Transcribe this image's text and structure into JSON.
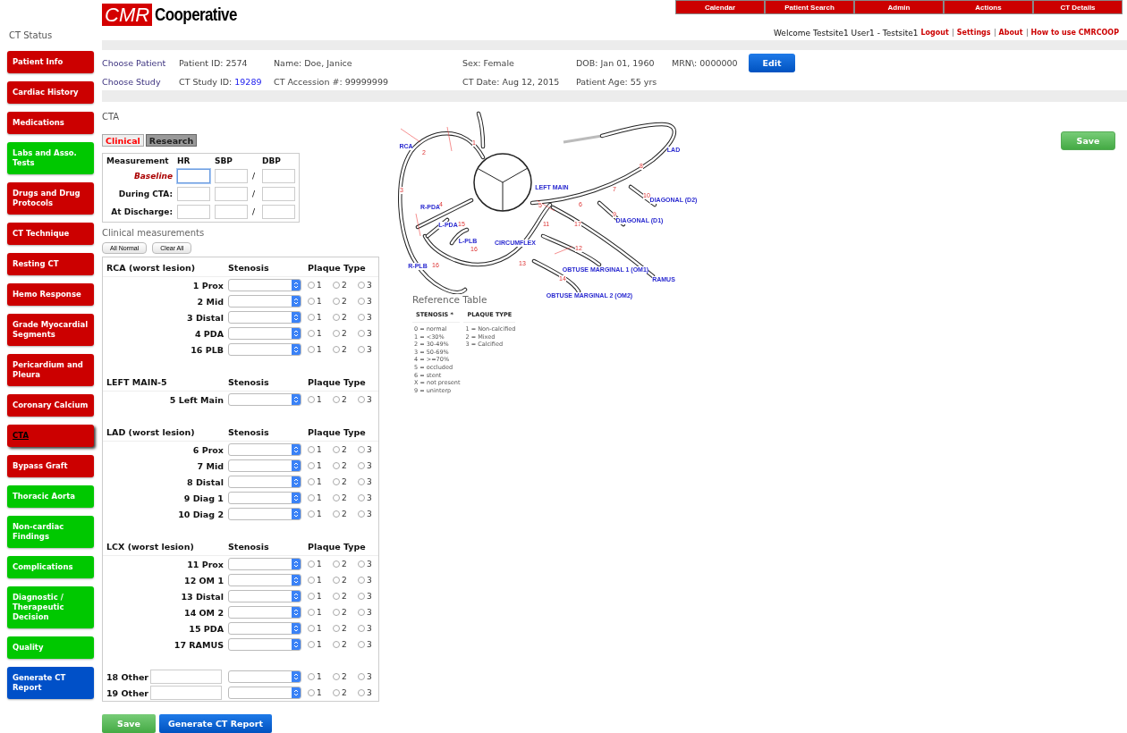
{
  "logo": {
    "badge": "CMR",
    "text": "Cooperative"
  },
  "top_nav": [
    "Calendar",
    "Patient Search",
    "Admin",
    "Actions",
    "CT Details"
  ],
  "user_bar": {
    "welcome": "Welcome Testsite1 User1 - Testsite1",
    "links": [
      "Logout",
      "Settings",
      "About",
      "How to use CMRCOOP"
    ]
  },
  "sidebar": {
    "title": "CT Status",
    "items": [
      {
        "label": "Patient Info",
        "color": "#cc0000",
        "selected": false
      },
      {
        "label": "Cardiac History",
        "color": "#cc0000",
        "selected": false
      },
      {
        "label": "Medications",
        "color": "#cc0000",
        "selected": false
      },
      {
        "label": "Labs and Asso. Tests",
        "color": "#00c800",
        "selected": false
      },
      {
        "label": "Drugs and Drug Protocols",
        "color": "#cc0000",
        "selected": false
      },
      {
        "label": "CT Technique",
        "color": "#cc0000",
        "selected": false
      },
      {
        "label": "Resting CT",
        "color": "#cc0000",
        "selected": false
      },
      {
        "label": "Hemo Response",
        "color": "#cc0000",
        "selected": false
      },
      {
        "label": "Grade Myocardial Segments",
        "color": "#cc0000",
        "selected": false
      },
      {
        "label": "Pericardium and Pleura",
        "color": "#cc0000",
        "selected": false
      },
      {
        "label": "Coronary Calcium",
        "color": "#cc0000",
        "selected": false
      },
      {
        "label": "CTA",
        "color": "#cc0000",
        "selected": true
      },
      {
        "label": "Bypass Graft",
        "color": "#cc0000",
        "selected": false
      },
      {
        "label": "Thoracic Aorta",
        "color": "#00c800",
        "selected": false
      },
      {
        "label": "Non-cardiac Findings",
        "color": "#00c800",
        "selected": false
      },
      {
        "label": "Complications",
        "color": "#00c800",
        "selected": false
      },
      {
        "label": "Diagnostic / Therapeutic Decision",
        "color": "#00c800",
        "selected": false
      },
      {
        "label": "Quality",
        "color": "#00c800",
        "selected": false
      },
      {
        "label": "Generate CT Report",
        "color": "#0050c8",
        "selected": false
      }
    ]
  },
  "patient": {
    "rows": [
      [
        {
          "kind": "link",
          "text": "Choose Patient"
        },
        {
          "kind": "text",
          "text": "Patient ID: 2574"
        },
        {
          "kind": "text",
          "text": "Name: Doe, Janice"
        },
        {
          "kind": "text",
          "text": "Sex: Female"
        },
        {
          "kind": "text",
          "text": "DOB: Jan 01, 1960"
        },
        {
          "kind": "text",
          "text": "MRN\\: 0000000"
        },
        {
          "kind": "button",
          "text": "Edit"
        }
      ],
      [
        {
          "kind": "link",
          "text": "Choose Study"
        },
        {
          "kind": "linked",
          "text": "CT Study ID:",
          "link": "19289"
        },
        {
          "kind": "text",
          "text": "CT Accession #: 99999999"
        },
        {
          "kind": "text",
          "text": "CT Date: Aug 12, 2015"
        },
        {
          "kind": "text",
          "text": "Patient Age: 55 yrs"
        }
      ]
    ]
  },
  "section_title": "CTA",
  "tabs": [
    {
      "label": "Clinical",
      "selected": true
    },
    {
      "label": "Research",
      "selected": false
    }
  ],
  "save_top": "Save",
  "vitals": {
    "columns": [
      "Measurement",
      "HR",
      "SBP",
      "DBP"
    ],
    "rows": [
      {
        "label": "Baseline",
        "active": true,
        "separator": "/"
      },
      {
        "label": "During CTA:",
        "active": false,
        "separator": "/"
      },
      {
        "label": "At Discharge:",
        "active": false,
        "separator": "/"
      }
    ]
  },
  "clinical": {
    "title": "Clinical measurements",
    "buttons": [
      "All Normal",
      "Clear All"
    ],
    "groups": [
      {
        "title": "RCA (worst lesion)",
        "stenosis_header": "Stenosis",
        "plaque_header": "Plaque Type",
        "segments": [
          {
            "kind": "fixed",
            "label": "1 Prox",
            "plaque": [
              {
                "label": "1",
                "selected": false
              },
              {
                "label": "2",
                "selected": false
              },
              {
                "label": "3",
                "selected": false
              }
            ]
          },
          {
            "kind": "fixed",
            "label": "2 Mid",
            "plaque": [
              {
                "label": "1",
                "selected": false
              },
              {
                "label": "2",
                "selected": false
              },
              {
                "label": "3",
                "selected": false
              }
            ]
          },
          {
            "kind": "fixed",
            "label": "3 Distal",
            "plaque": [
              {
                "label": "1",
                "selected": false
              },
              {
                "label": "2",
                "selected": false
              },
              {
                "label": "3",
                "selected": false
              }
            ]
          },
          {
            "kind": "fixed",
            "label": "4 PDA",
            "plaque": [
              {
                "label": "1",
                "selected": false
              },
              {
                "label": "2",
                "selected": false
              },
              {
                "label": "3",
                "selected": false
              }
            ]
          },
          {
            "kind": "fixed",
            "label": "16 PLB",
            "plaque": [
              {
                "label": "1",
                "selected": false
              },
              {
                "label": "2",
                "selected": false
              },
              {
                "label": "3",
                "selected": false
              }
            ]
          }
        ]
      },
      {
        "title": "LEFT MAIN-5",
        "stenosis_header": "Stenosis",
        "plaque_header": "Plaque Type",
        "segments": [
          {
            "kind": "fixed",
            "label": "5 Left Main",
            "plaque": [
              {
                "label": "1",
                "selected": false
              },
              {
                "label": "2",
                "selected": false
              },
              {
                "label": "3",
                "selected": false
              }
            ]
          }
        ]
      },
      {
        "title": "LAD (worst lesion)",
        "stenosis_header": "Stenosis",
        "plaque_header": "Plaque Type",
        "segments": [
          {
            "kind": "fixed",
            "label": "6 Prox",
            "plaque": [
              {
                "label": "1",
                "selected": false
              },
              {
                "label": "2",
                "selected": false
              },
              {
                "label": "3",
                "selected": false
              }
            ]
          },
          {
            "kind": "fixed",
            "label": "7 Mid",
            "plaque": [
              {
                "label": "1",
                "selected": false
              },
              {
                "label": "2",
                "selected": false
              },
              {
                "label": "3",
                "selected": false
              }
            ]
          },
          {
            "kind": "fixed",
            "label": "8 Distal",
            "plaque": [
              {
                "label": "1",
                "selected": false
              },
              {
                "label": "2",
                "selected": false
              },
              {
                "label": "3",
                "selected": false
              }
            ]
          },
          {
            "kind": "fixed",
            "label": "9 Diag 1",
            "plaque": [
              {
                "label": "1",
                "selected": false
              },
              {
                "label": "2",
                "selected": false
              },
              {
                "label": "3",
                "selected": false
              }
            ]
          },
          {
            "kind": "fixed",
            "label": "10 Diag 2",
            "plaque": [
              {
                "label": "1",
                "selected": false
              },
              {
                "label": "2",
                "selected": false
              },
              {
                "label": "3",
                "selected": false
              }
            ]
          }
        ]
      },
      {
        "title": "LCX (worst lesion)",
        "stenosis_header": "Stenosis",
        "plaque_header": "Plaque Type",
        "segments": [
          {
            "kind": "fixed",
            "label": "11 Prox",
            "plaque": [
              {
                "label": "1",
                "selected": false
              },
              {
                "label": "2",
                "selected": false
              },
              {
                "label": "3",
                "selected": false
              }
            ]
          },
          {
            "kind": "fixed",
            "label": "12 OM 1",
            "plaque": [
              {
                "label": "1",
                "selected": false
              },
              {
                "label": "2",
                "selected": false
              },
              {
                "label": "3",
                "selected": false
              }
            ]
          },
          {
            "kind": "fixed",
            "label": "13 Distal",
            "plaque": [
              {
                "label": "1",
                "selected": false
              },
              {
                "label": "2",
                "selected": false
              },
              {
                "label": "3",
                "selected": false
              }
            ]
          },
          {
            "kind": "fixed",
            "label": "14 OM 2",
            "plaque": [
              {
                "label": "1",
                "selected": false
              },
              {
                "label": "2",
                "selected": false
              },
              {
                "label": "3",
                "selected": false
              }
            ]
          },
          {
            "kind": "fixed",
            "label": "15 PDA",
            "plaque": [
              {
                "label": "1",
                "selected": false
              },
              {
                "label": "2",
                "selected": false
              },
              {
                "label": "3",
                "selected": false
              }
            ]
          },
          {
            "kind": "fixed",
            "label": "17 RAMUS",
            "plaque": [
              {
                "label": "1",
                "selected": false
              },
              {
                "label": "2",
                "selected": false
              },
              {
                "label": "3",
                "selected": false
              }
            ]
          }
        ]
      },
      {
        "segments": [
          {
            "kind": "other",
            "label": "18 Other",
            "plaque": [
              {
                "label": "1",
                "selected": false
              },
              {
                "label": "2",
                "selected": false
              },
              {
                "label": "3",
                "selected": false
              }
            ]
          },
          {
            "kind": "other",
            "label": "19 Other",
            "plaque": [
              {
                "label": "1",
                "selected": false
              },
              {
                "label": "2",
                "selected": false
              },
              {
                "label": "3",
                "selected": false
              }
            ]
          }
        ]
      }
    ]
  },
  "diagram": {
    "vessel_labels": [
      "RCA",
      "LAD",
      "LEFT MAIN",
      "DIAGONAL (D2)",
      "DIAGONAL (D1)",
      "R-PDA",
      "L-PDA",
      "L-PLB",
      "CIRCUMFLEX",
      "R-PLB",
      "OBTUSE MARGINAL 1 (OM1)",
      "RAMUS",
      "OBTUSE MARGINAL 2 (OM2)"
    ],
    "segment_numbers": [
      "1",
      "2",
      "3",
      "4",
      "5",
      "6",
      "7",
      "8",
      "9",
      "10",
      "11",
      "12",
      "13",
      "14",
      "15",
      "16",
      "17",
      "16"
    ]
  },
  "reference": {
    "title": "Reference Table",
    "columns": [
      {
        "header": "STENOSIS *",
        "lines": [
          "0 = normal",
          "1 = <30%",
          "2 = 30-49%",
          "3 = 50-69%",
          "4 = >=70%",
          "5 = occluded",
          "6 = stent",
          "X = not present",
          "9 = uninterp"
        ]
      },
      {
        "header": "PLAQUE TYPE",
        "lines": [
          "1 = Non-calcified",
          "2 = Mixed",
          "3 = Calcified"
        ]
      }
    ]
  },
  "bottom_buttons": [
    {
      "kind": "save",
      "label": "Save"
    },
    {
      "kind": "report",
      "label": "Generate CT Report"
    }
  ]
}
